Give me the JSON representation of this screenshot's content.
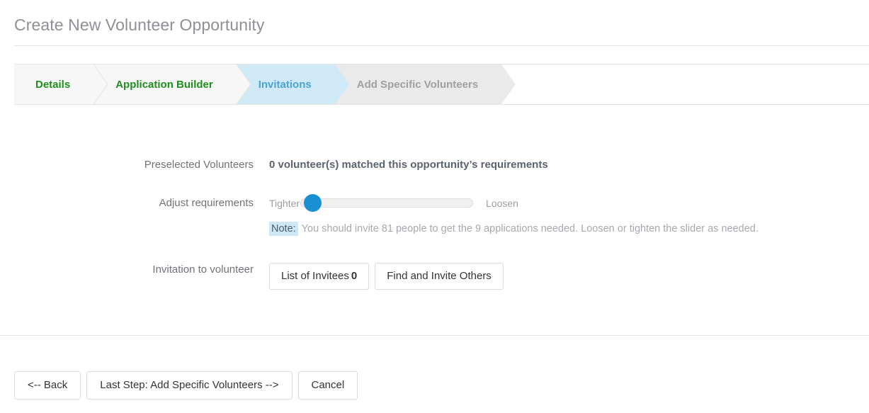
{
  "page": {
    "title": "Create New Volunteer Opportunity"
  },
  "steps": [
    {
      "label": "Details",
      "state": "done"
    },
    {
      "label": "Application Builder",
      "state": "done"
    },
    {
      "label": "Invitations",
      "state": "current"
    },
    {
      "label": "Add Specific Volunteers",
      "state": "todo"
    }
  ],
  "form": {
    "preselected": {
      "label": "Preselected Volunteers",
      "matched_text": "0 volunteer(s) matched this opportunity’s requirements"
    },
    "adjust": {
      "label": "Adjust requirements",
      "slider_left_label": "Tighter",
      "slider_right_label": "Loosen",
      "slider_value": 8,
      "slider_min": 0,
      "slider_max": 100
    },
    "note": {
      "tag": "Note:",
      "text": "You should invite 81 people to get the 9 applications needed. Loosen or tighten the slider as needed.",
      "invite_count": 81,
      "applications_needed": 9
    },
    "invitation": {
      "label": "Invitation to volunteer",
      "list_button_label": "List of Invitees",
      "list_button_count": "0",
      "find_button_label": "Find and Invite Others"
    }
  },
  "footer": {
    "back_label": "<-- Back",
    "next_label": "Last Step: Add Specific Volunteers -->",
    "cancel_label": "Cancel"
  },
  "colors": {
    "step_done": "#1d8f1d",
    "step_current_text": "#4ba3d3",
    "step_current_bg": "#cfe9f6",
    "step_todo_bg": "#eaeaea",
    "slider_handle": "#1b8fd4",
    "note_highlight": "#cfe8f5"
  }
}
